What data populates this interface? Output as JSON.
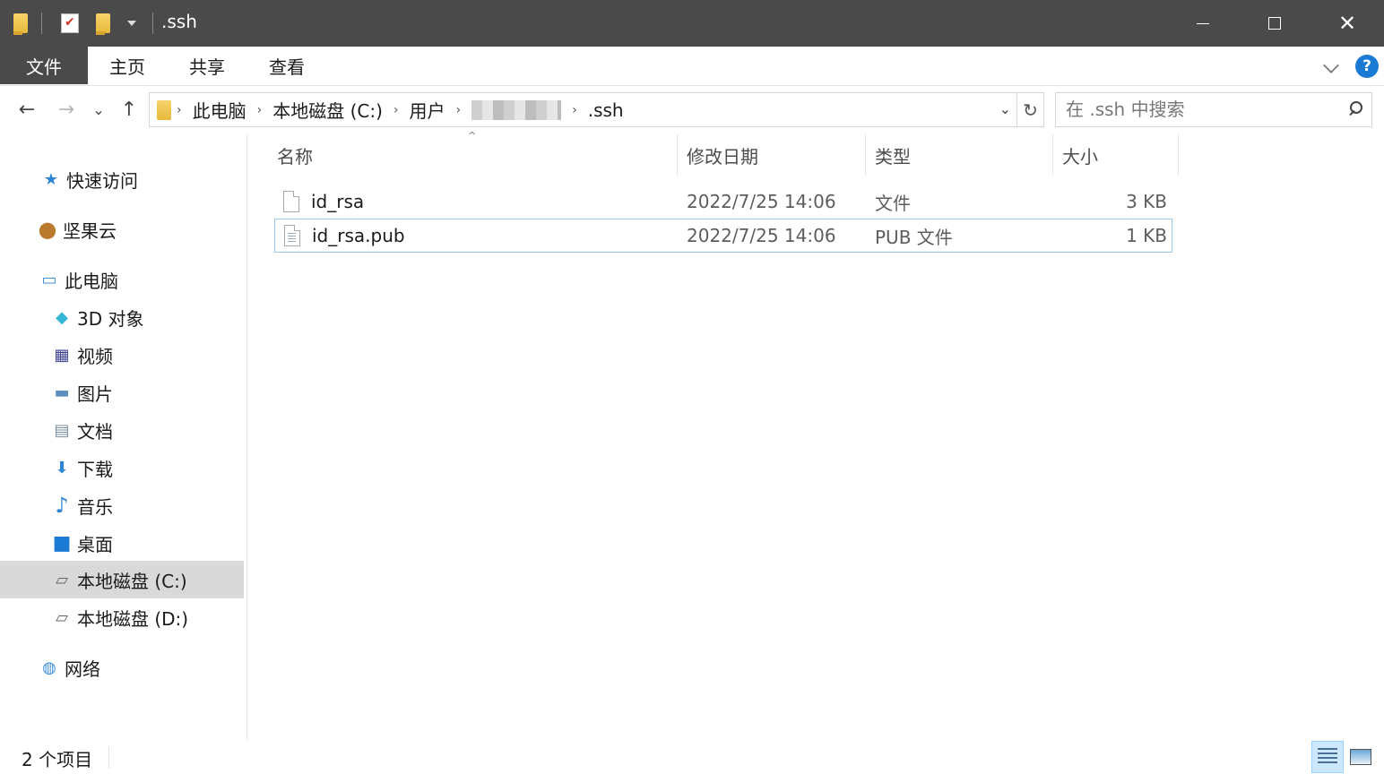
{
  "window": {
    "title": ".ssh",
    "minimize_icon": "minimize-icon",
    "maximize_icon": "maximize-icon",
    "close_icon": "close-icon",
    "close_glyph": "✕"
  },
  "ribbon": {
    "tabs": [
      "文件",
      "主页",
      "共享",
      "查看"
    ],
    "help_glyph": "?"
  },
  "nav": {
    "back_glyph": "←",
    "forward_glyph": "→",
    "recent_glyph": "⌄",
    "up_glyph": "↑",
    "breadcrumb": [
      "此电脑",
      "本地磁盘 (C:)",
      "用户",
      ".ssh"
    ],
    "crumb_sep": "›",
    "refresh_glyph": "↻",
    "dropdown_glyph": "⌄"
  },
  "search": {
    "placeholder": "在 .ssh 中搜索",
    "value": ""
  },
  "sidebar": {
    "items": [
      {
        "label": "快速访问",
        "icon": "star-icon",
        "glyph": "★"
      },
      {
        "label": "坚果云",
        "icon": "nut-icon",
        "glyph": "●"
      },
      {
        "label": "此电脑",
        "icon": "computer-icon",
        "glyph": "▭"
      },
      {
        "label": "3D 对象",
        "icon": "cube-icon",
        "glyph": "◆"
      },
      {
        "label": "视频",
        "icon": "film-icon",
        "glyph": "▦"
      },
      {
        "label": "图片",
        "icon": "picture-icon",
        "glyph": "▬"
      },
      {
        "label": "文档",
        "icon": "document-icon",
        "glyph": "▤"
      },
      {
        "label": "下载",
        "icon": "download-icon",
        "glyph": "⬇"
      },
      {
        "label": "音乐",
        "icon": "music-icon",
        "glyph": "♪"
      },
      {
        "label": "桌面",
        "icon": "desktop-icon",
        "glyph": "■"
      },
      {
        "label": "本地磁盘 (C:)",
        "icon": "drive-c-icon",
        "glyph": "▱"
      },
      {
        "label": "本地磁盘 (D:)",
        "icon": "drive-d-icon",
        "glyph": "▱"
      },
      {
        "label": "网络",
        "icon": "network-icon",
        "glyph": "◍"
      }
    ]
  },
  "columns": [
    "名称",
    "修改日期",
    "类型",
    "大小"
  ],
  "sort_glyph": "^",
  "files": [
    {
      "name": "id_rsa",
      "modified": "2022/7/25 14:06",
      "type": "文件",
      "size": "3 KB"
    },
    {
      "name": "id_rsa.pub",
      "modified": "2022/7/25 14:06",
      "type": "PUB 文件",
      "size": "1 KB"
    }
  ],
  "status": {
    "item_count": "2 个项目"
  },
  "colors": {
    "titlebar": "#4a4a4a",
    "selection_border": "#99c9ef",
    "sidebar_selected": "#d9d9d9",
    "accent": "#1a7ad4"
  }
}
